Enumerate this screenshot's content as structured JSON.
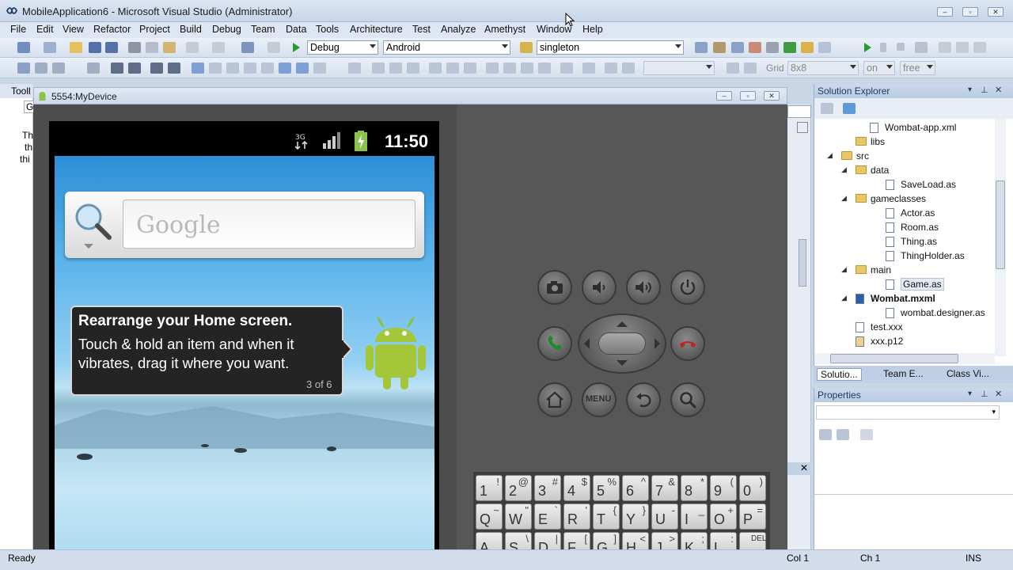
{
  "window": {
    "title": "MobileApplication6 - Microsoft Visual Studio (Administrator)"
  },
  "menu": [
    "File",
    "Edit",
    "View",
    "Refactor",
    "Project",
    "Build",
    "Debug",
    "Team",
    "Data",
    "Tools",
    "Architecture",
    "Test",
    "Analyze",
    "Amethyst",
    "Window",
    "Help"
  ],
  "toolbar": {
    "config": "Debug",
    "platform": "Android",
    "search": "singleton",
    "grid_label": "Grid",
    "grid_value": "8x8",
    "snap_value": "on",
    "mode_value": "free"
  },
  "toolbox": {
    "title": "Tooll",
    "text": [
      "Th",
      "th",
      "thi"
    ],
    "tab": "G"
  },
  "emulator": {
    "title": "5554:MyDevice",
    "clock": "11:50",
    "google_placeholder": "Google",
    "bubble": {
      "heading": "Rearrange your Home screen.",
      "body": "Touch & hold an item and when it vibrates, drag it where you want.",
      "counter": "3 of 6"
    },
    "buttons": {
      "menu_label": "MENU"
    },
    "keyboard": {
      "row1": [
        [
          "1",
          "!"
        ],
        [
          "2",
          "@"
        ],
        [
          "3",
          "#"
        ],
        [
          "4",
          "$"
        ],
        [
          "5",
          "%"
        ],
        [
          "6",
          "^"
        ],
        [
          "7",
          "&"
        ],
        [
          "8",
          "*"
        ],
        [
          "9",
          "("
        ],
        [
          "0",
          ")"
        ]
      ],
      "row2": [
        [
          "Q",
          "~"
        ],
        [
          "W",
          "\""
        ],
        [
          "E",
          "`"
        ],
        [
          "R",
          "'"
        ],
        [
          "T",
          "{"
        ],
        [
          "Y",
          "}"
        ],
        [
          "U",
          "-"
        ],
        [
          "I",
          "_"
        ],
        [
          "O",
          "+"
        ],
        [
          "P",
          "="
        ]
      ],
      "row3": [
        [
          "A",
          ""
        ],
        [
          "S",
          "\\"
        ],
        [
          "D",
          "|"
        ],
        [
          "F",
          "["
        ],
        [
          "G",
          "]"
        ],
        [
          "H",
          "<"
        ],
        [
          "J",
          ">"
        ],
        [
          "K",
          ";"
        ],
        [
          "L",
          ":"
        ],
        [
          "DEL",
          ""
        ]
      ]
    }
  },
  "solution_explorer": {
    "title": "Solution Explorer",
    "items": [
      {
        "label": "Wombat-app.xml",
        "type": "doc",
        "bold": false
      },
      {
        "label": "libs",
        "type": "folder",
        "bold": false
      },
      {
        "label": "src",
        "type": "folder",
        "bold": false,
        "expander": "◢"
      },
      {
        "label": "data",
        "type": "folder",
        "bold": false,
        "expander": "◢"
      },
      {
        "label": "SaveLoad.as",
        "type": "doc",
        "bold": false
      },
      {
        "label": "gameclasses",
        "type": "folder",
        "bold": false,
        "expander": "◢"
      },
      {
        "label": "Actor.as",
        "type": "doc",
        "bold": false
      },
      {
        "label": "Room.as",
        "type": "doc",
        "bold": false
      },
      {
        "label": "Thing.as",
        "type": "doc",
        "bold": false
      },
      {
        "label": "ThingHolder.as",
        "type": "doc",
        "bold": false
      },
      {
        "label": "main",
        "type": "folder",
        "bold": false,
        "expander": "◢"
      },
      {
        "label": "Game.as",
        "type": "doc",
        "bold": false,
        "selected": true
      },
      {
        "label": "Wombat.mxml",
        "type": "mxml",
        "bold": true,
        "expander": "◢"
      },
      {
        "label": "wombat.designer.as",
        "type": "doc",
        "bold": false
      },
      {
        "label": "test.xxx",
        "type": "doc",
        "bold": false
      },
      {
        "label": "xxx.p12",
        "type": "cert",
        "bold": false
      }
    ],
    "tabs": [
      "Solutio...",
      "Team E...",
      "Class Vi..."
    ]
  },
  "properties": {
    "title": "Properties"
  },
  "statusbar": {
    "left": "Ready",
    "col": "Col 1",
    "ch": "Ch 1",
    "ins": "INS"
  }
}
